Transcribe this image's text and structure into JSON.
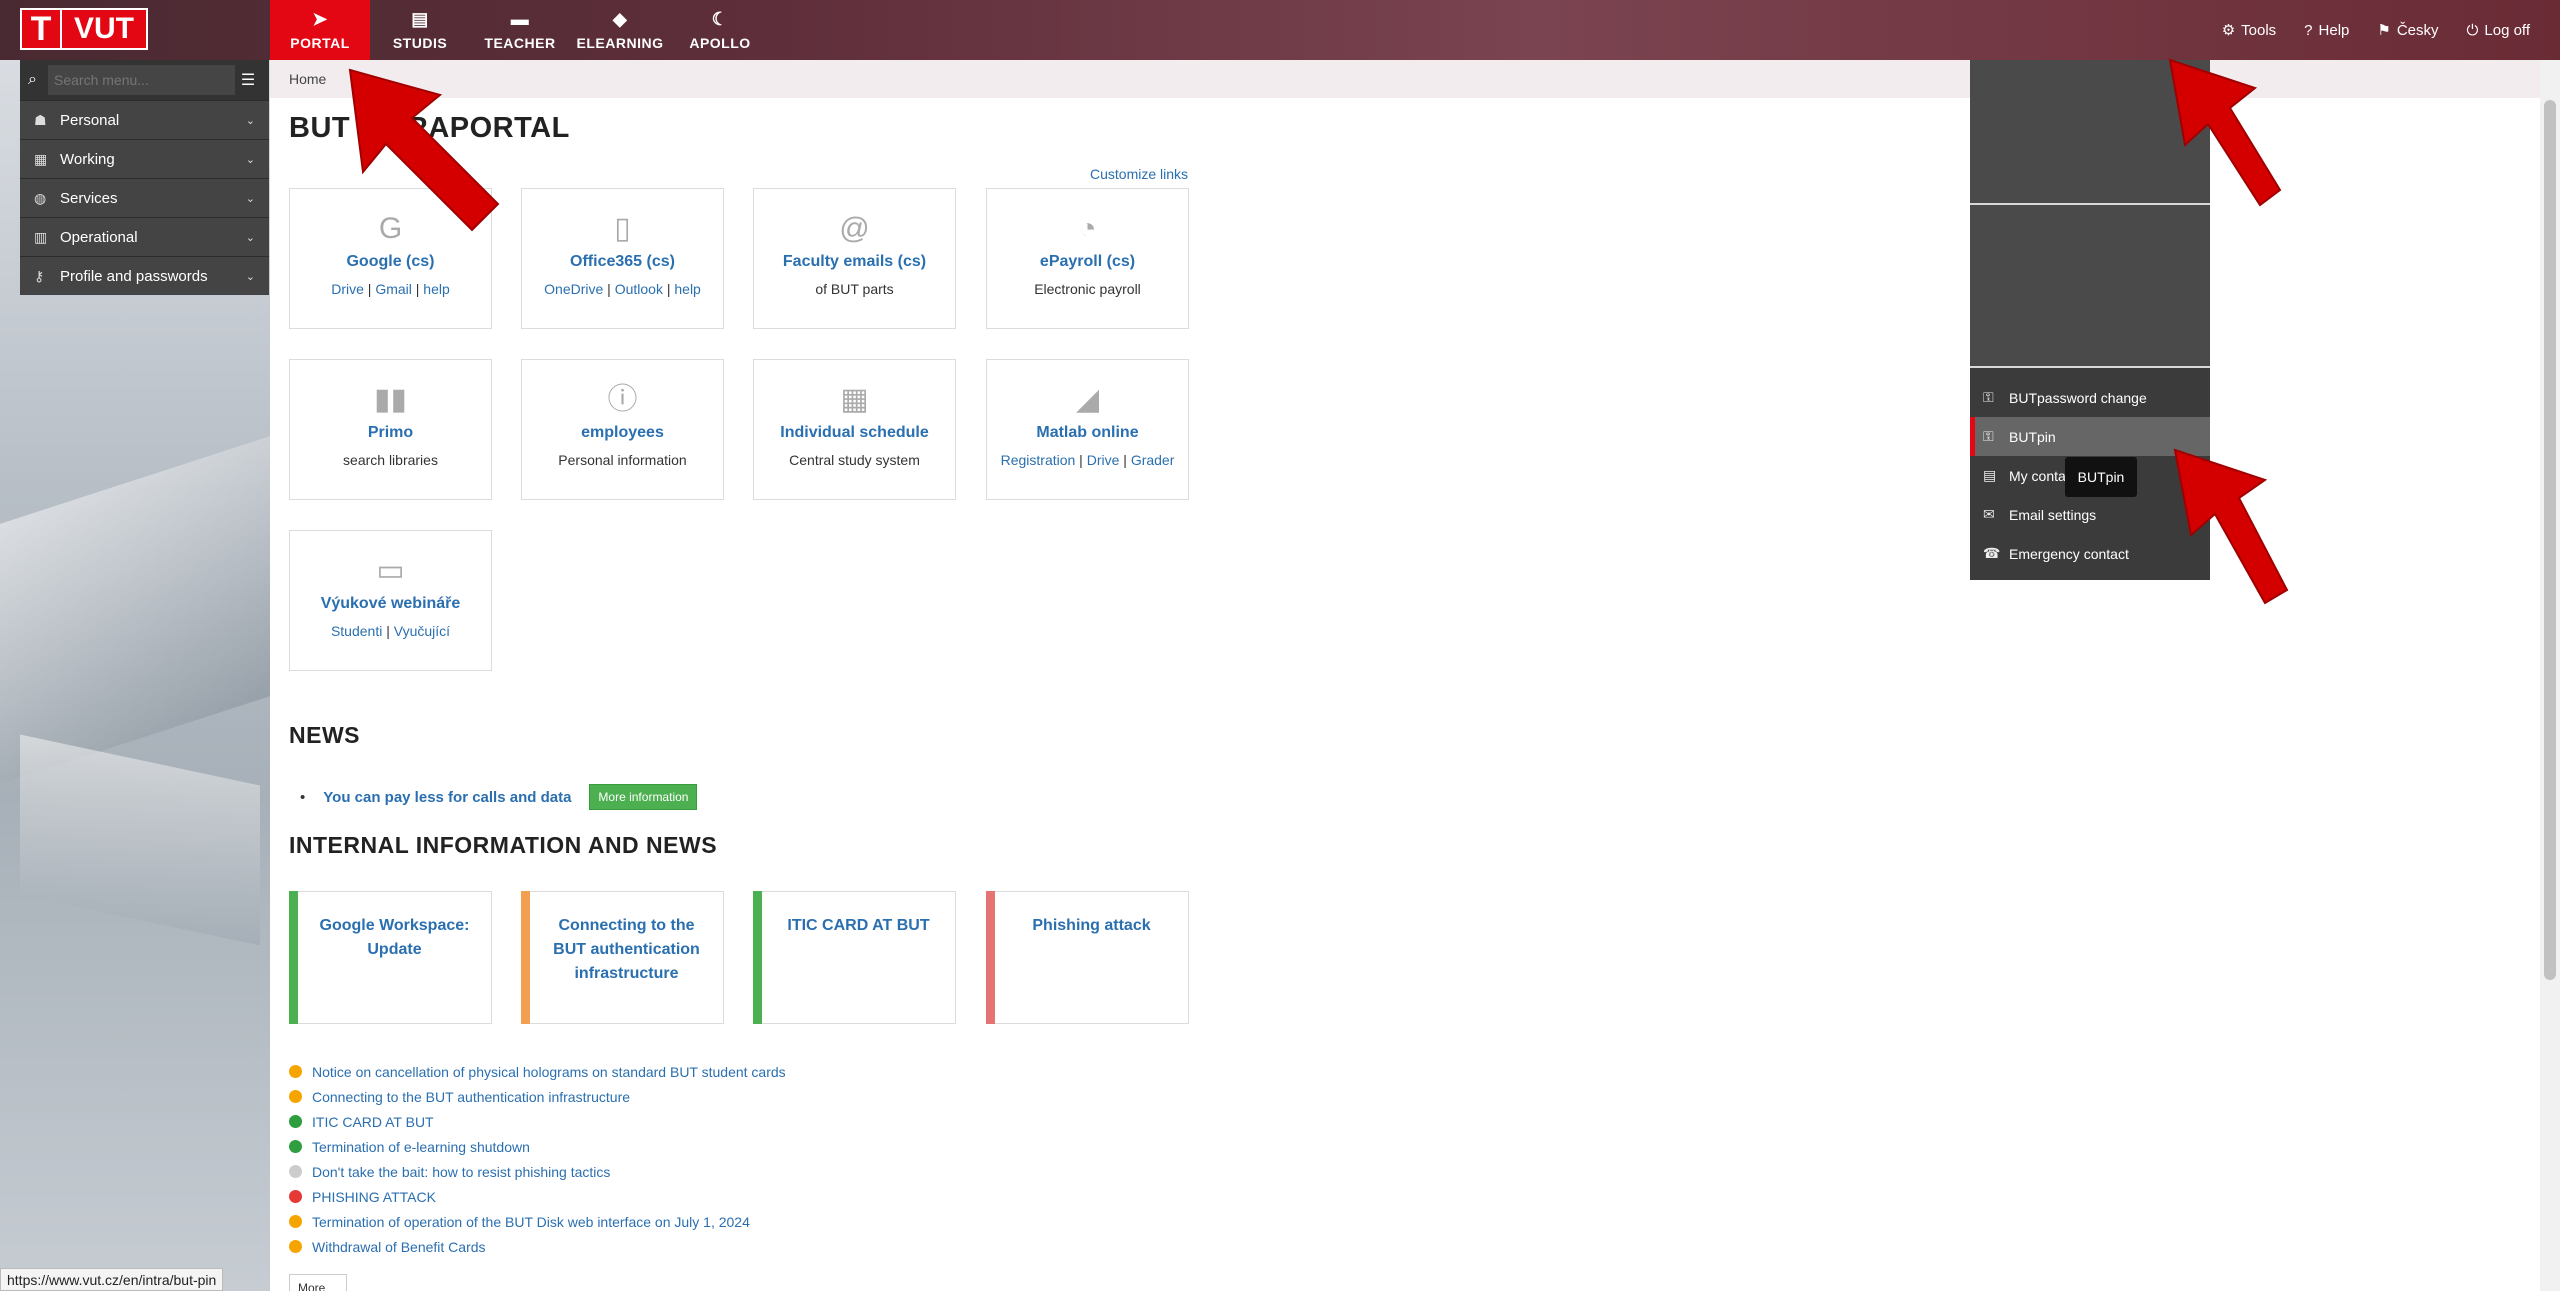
{
  "logo": {
    "letter": "T",
    "name": "VUT"
  },
  "topnav": [
    {
      "label": "PORTAL",
      "icon": "paper-plane-icon",
      "glyph": "➤"
    },
    {
      "label": "STUDIS",
      "icon": "document-icon",
      "glyph": "▤"
    },
    {
      "label": "TEACHER",
      "icon": "briefcase-icon",
      "glyph": "▬"
    },
    {
      "label": "ELEARNING",
      "icon": "graduation-cap-icon",
      "glyph": "◆"
    },
    {
      "label": "APOLLO",
      "icon": "moon-icon",
      "glyph": "☾"
    }
  ],
  "tools": [
    {
      "label": "Tools",
      "glyph": "⚙"
    },
    {
      "label": "Help",
      "glyph": "?"
    },
    {
      "label": "Česky",
      "glyph": "⚑"
    },
    {
      "label": "Log off",
      "glyph": "⏻"
    }
  ],
  "sidebar": {
    "search_placeholder": "Search menu...",
    "items": [
      {
        "label": "Personal",
        "glyph": "☗"
      },
      {
        "label": "Working",
        "glyph": "▦"
      },
      {
        "label": "Services",
        "glyph": "◍"
      },
      {
        "label": "Operational",
        "glyph": "▥"
      },
      {
        "label": "Profile and passwords",
        "glyph": "⚷"
      }
    ]
  },
  "breadcrumb": "Home",
  "page_title": "BUT INTRAPORTAL",
  "customize_links": "Customize links",
  "tiles": [
    {
      "title": "Google (cs)",
      "glyph": "G",
      "links": [
        "Drive",
        "Gmail",
        "help"
      ]
    },
    {
      "title": "Office365 (cs)",
      "glyph": "▯",
      "links": [
        "OneDrive",
        "Outlook",
        "help"
      ]
    },
    {
      "title": "Faculty emails (cs)",
      "glyph": "@",
      "desc": "of BUT parts"
    },
    {
      "title": "ePayroll (cs)",
      "glyph": "◔",
      "desc": "Electronic payroll"
    },
    {
      "title": "Primo",
      "glyph": "▮▮",
      "desc": "search libraries"
    },
    {
      "title": "employees",
      "glyph": "ⓘ",
      "desc": "Personal information"
    },
    {
      "title": "Individual schedule",
      "glyph": "▦",
      "desc": "Central study system"
    },
    {
      "title": "Matlab online",
      "glyph": "◢",
      "links": [
        "Registration",
        "Drive",
        "Grader"
      ]
    },
    {
      "title": "Výukové webináře",
      "glyph": "▭",
      "links": [
        "Studenti",
        "Vyučující"
      ]
    }
  ],
  "news": {
    "heading": "NEWS",
    "item": "You can pay less for calls and data",
    "button": "More information"
  },
  "internal": {
    "heading": "INTERNAL INFORMATION AND NEWS",
    "cards": [
      {
        "title": "Google Workspace: Update",
        "color": "#4caf50"
      },
      {
        "title": "Connecting to the BUT authentication infrastructure",
        "color": "#f0a050"
      },
      {
        "title": "ITIC CARD AT BUT",
        "color": "#4caf50"
      },
      {
        "title": "Phishing attack",
        "color": "#e57373"
      }
    ],
    "list": [
      {
        "text": "Notice on cancellation of physical holograms on standard BUT student cards",
        "color": "#f5a400"
      },
      {
        "text": "Connecting to the BUT authentication infrastructure",
        "color": "#f5a400"
      },
      {
        "text": "ITIC CARD AT BUT",
        "color": "#2e9e3e"
      },
      {
        "text": "Termination of e-learning shutdown",
        "color": "#2e9e3e"
      },
      {
        "text": "Don't take the bait: how to resist phishing tactics",
        "color": "#cccccc"
      },
      {
        "text": "PHISHING ATTACK",
        "color": "#e53935"
      },
      {
        "text": "Termination of operation of the BUT Disk web interface on July 1, 2024",
        "color": "#f5a400"
      },
      {
        "text": "Withdrawal of Benefit Cards",
        "color": "#f5a400"
      }
    ],
    "more": "More"
  },
  "dropdown": {
    "items": [
      {
        "label": "BUTpassword change",
        "glyph": "⚿"
      },
      {
        "label": "BUTpin",
        "glyph": "⚿"
      },
      {
        "label": "My contacts",
        "glyph": "▤"
      },
      {
        "label": "Email settings",
        "glyph": "✉"
      },
      {
        "label": "Emergency contact",
        "glyph": "☎"
      }
    ],
    "tooltip": "BUTpin"
  },
  "status_url": "https://www.vut.cz/en/intra/but-pin",
  "colors": {
    "accent": "#e30613",
    "link": "#2a6fb0",
    "arrow": "#d40000"
  }
}
